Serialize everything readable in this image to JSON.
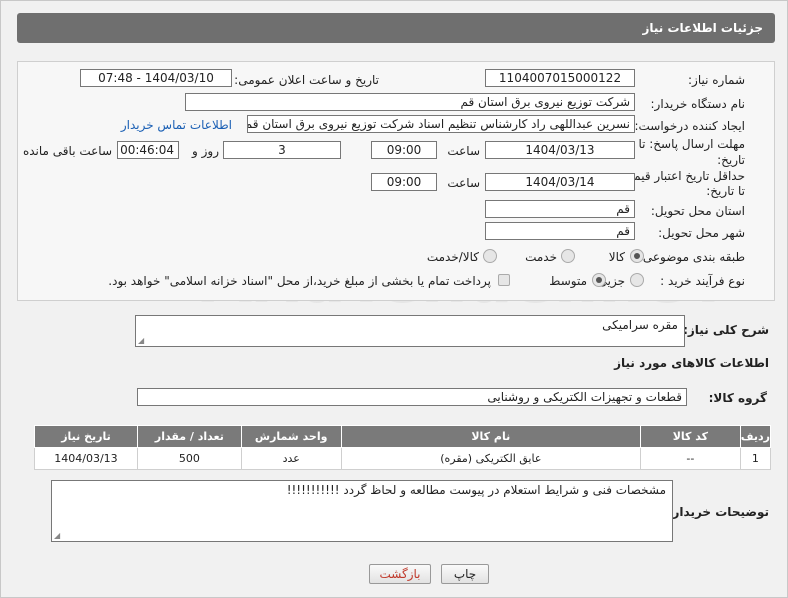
{
  "header": {
    "title": "جزئیات اطلاعات نیاز"
  },
  "form": {
    "need_number_label": "شماره نیاز:",
    "need_number": "1104007015000122",
    "announce_label": "تاریخ و ساعت اعلان عمومی:",
    "announce_value": "1404/03/10 - 07:48",
    "buyer_label": "نام دستگاه خریدار:",
    "buyer_value": "شرکت توزیع نیروی برق استان قم",
    "creator_label": "ایجاد کننده درخواست:",
    "creator_value": "نسرین عبداللهی راد کارشناس تنظیم اسناد شرکت توزیع نیروی برق استان قم",
    "contact_link": "اطلاعات تماس خریدار",
    "deadline_label_1": "مهلت ارسال پاسخ: تا",
    "deadline_label_2": "تاریخ:",
    "deadline_date": "1404/03/13",
    "time_label": "ساعت",
    "deadline_time": "09:00",
    "days_value": "3",
    "days_label": "روز و",
    "remaining_value": "00:46:04",
    "remaining_label": "ساعت باقی مانده",
    "validity_label_1": "حداقل تاریخ اعتبار قیمت:",
    "validity_label_2": "تا تاریخ:",
    "validity_date": "1404/03/14",
    "validity_time": "09:00",
    "province_label": "استان محل تحویل:",
    "province_value": "قم",
    "city_label": "شهر محل تحویل:",
    "city_value": "قم",
    "category_label": "طبقه بندی موضوعی:",
    "category_options": [
      "کالا",
      "خدمت",
      "کالا/خدمت"
    ],
    "process_label": "نوع فرآیند خرید :",
    "process_options": [
      "جزیی",
      "متوسط"
    ],
    "payment_note": "پرداخت تمام یا بخشی از مبلغ خرید،از محل \"اسناد خزانه اسلامی\" خواهد بود."
  },
  "description": {
    "label": "شرح کلی نیاز:",
    "value": "مقره سرامیکی"
  },
  "goods_section": {
    "title": "اطلاعات کالاهای مورد نیاز",
    "group_label": "گروه کالا:",
    "group_value": "قطعات و تجهیزات الکتریکی و روشنایی"
  },
  "table": {
    "headers": [
      "ردیف",
      "کد کالا",
      "نام کالا",
      "واحد شمارش",
      "تعداد / مقدار",
      "تاریخ نیاز"
    ],
    "rows": [
      [
        "1",
        "--",
        "عایق الکتریکی (مقره)",
        "عدد",
        "500",
        "1404/03/13"
      ]
    ]
  },
  "buyer_notes": {
    "label": "توضیحات خریدار:",
    "value": "مشخصات فنی و شرایط استعلام در پیوست مطالعه و لحاظ گردد !!!!!!!!!!!"
  },
  "buttons": {
    "print": "چاپ",
    "back": "بازگشت"
  },
  "watermark": "AriaTender.neT",
  "colors": {
    "title_bar": "#6f6f6f",
    "table_header": "#7a7a7a",
    "link": "#1a5fb4",
    "back_button_text": "#c0392b"
  }
}
